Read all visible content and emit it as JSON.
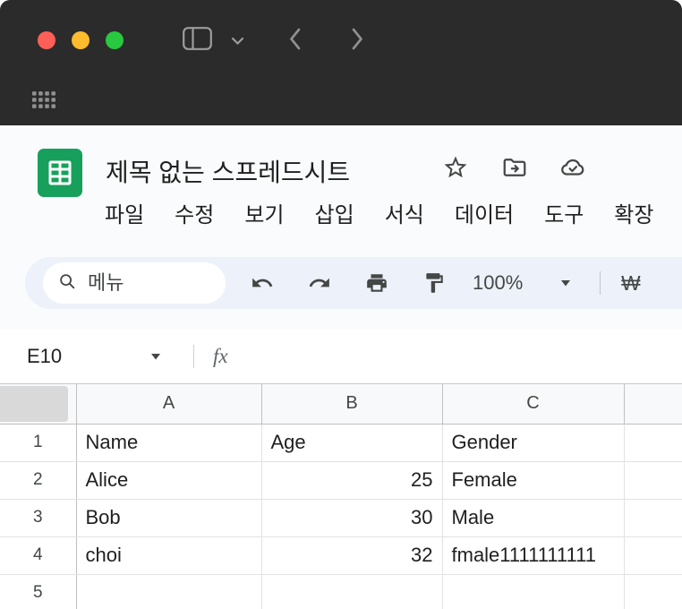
{
  "colors": {
    "chrome_bg": "#2b2b2b",
    "traffic_red": "#ff5f57",
    "traffic_yellow": "#febc2e",
    "traffic_green": "#28c840",
    "app_header_bg": "#f9fbfd",
    "toolbar_bg": "#edf2fa",
    "sheets_green": "#17a05c",
    "grid_line": "#e2e2e3",
    "header_line": "#c0c0c0",
    "icon_color": "#444746"
  },
  "app_header": {
    "title": "제목 없는 스프레드시트",
    "menus": [
      "파일",
      "수정",
      "보기",
      "삽입",
      "서식",
      "데이터",
      "도구",
      "확장"
    ]
  },
  "toolbar": {
    "search_placeholder": "메뉴",
    "zoom_level": "100%",
    "currency_symbol": "₩"
  },
  "formula_bar": {
    "name_box": "E10",
    "fx_label": "fx"
  },
  "grid": {
    "column_headers": [
      "A",
      "B",
      "C"
    ],
    "row_headers": [
      "1",
      "2",
      "3",
      "4",
      "5"
    ],
    "cells": [
      [
        "Name",
        "Age",
        "Gender"
      ],
      [
        "Alice",
        "25",
        "Female"
      ],
      [
        "Bob",
        "30",
        "Male"
      ],
      [
        "choi",
        "32",
        "fmale1111111111"
      ]
    ]
  }
}
